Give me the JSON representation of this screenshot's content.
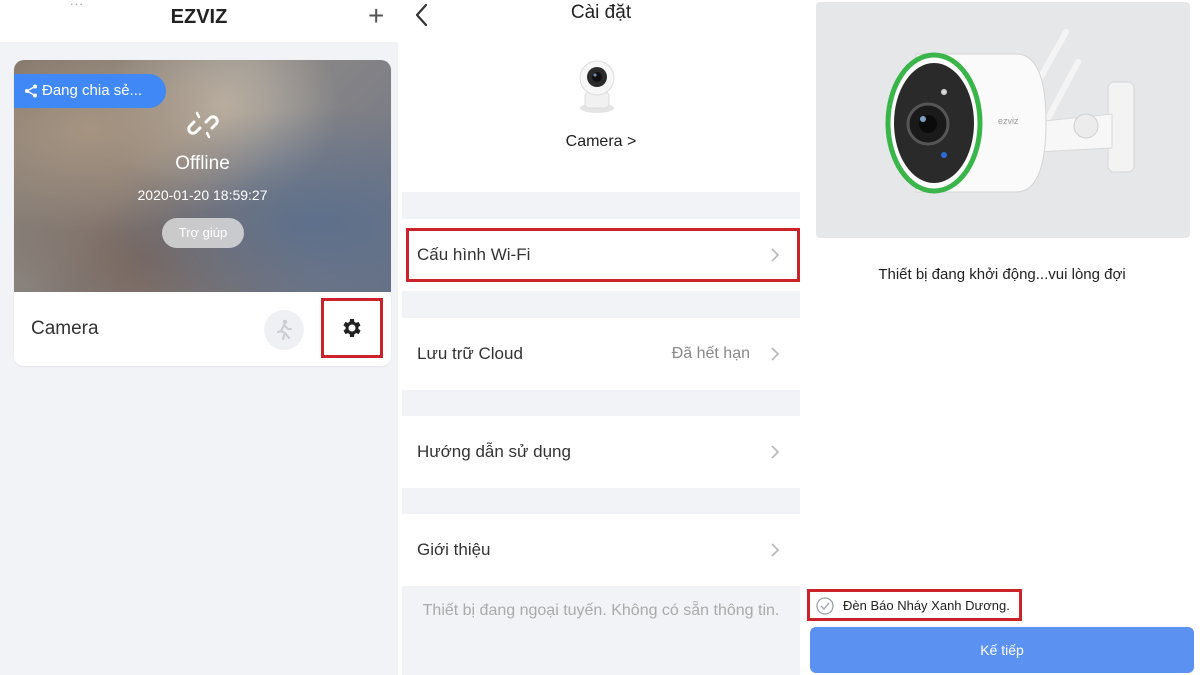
{
  "panel1": {
    "header_cut_text": "...",
    "app_title": "EZVIZ",
    "add_icon": "plus-icon",
    "device_card": {
      "share_label": "Đang chia sẻ...",
      "status": "Offline",
      "timestamp": "2020-01-20 18:59:27",
      "help_label": "Trợ giúp",
      "device_name": "Camera",
      "motion_icon": "motion-detection-icon",
      "settings_icon": "gear-icon"
    }
  },
  "panel2": {
    "title": "Cài đặt",
    "device_label": "Camera >",
    "rows": [
      {
        "label": "Cấu hình Wi-Fi",
        "value": ""
      },
      {
        "label": "Lưu trữ Cloud",
        "value": "Đã hết hạn"
      },
      {
        "label": "Hướng dẫn sử dụng",
        "value": ""
      },
      {
        "label": "Giới thiệu",
        "value": ""
      }
    ],
    "offline_note": "Thiết bị đang ngoại tuyến. Không có sẵn thông tin."
  },
  "panel3": {
    "booting_text": "Thiết bị đang khởi động...vui lòng đợi",
    "blink_label": "Đèn Báo Nháy Xanh Dương.",
    "next_button": "Kế tiếp"
  },
  "colors": {
    "accent_blue": "#3f88f5",
    "button_blue": "#5b92f2",
    "highlight_red": "#cc2229",
    "background_gray": "#f2f3f7"
  }
}
